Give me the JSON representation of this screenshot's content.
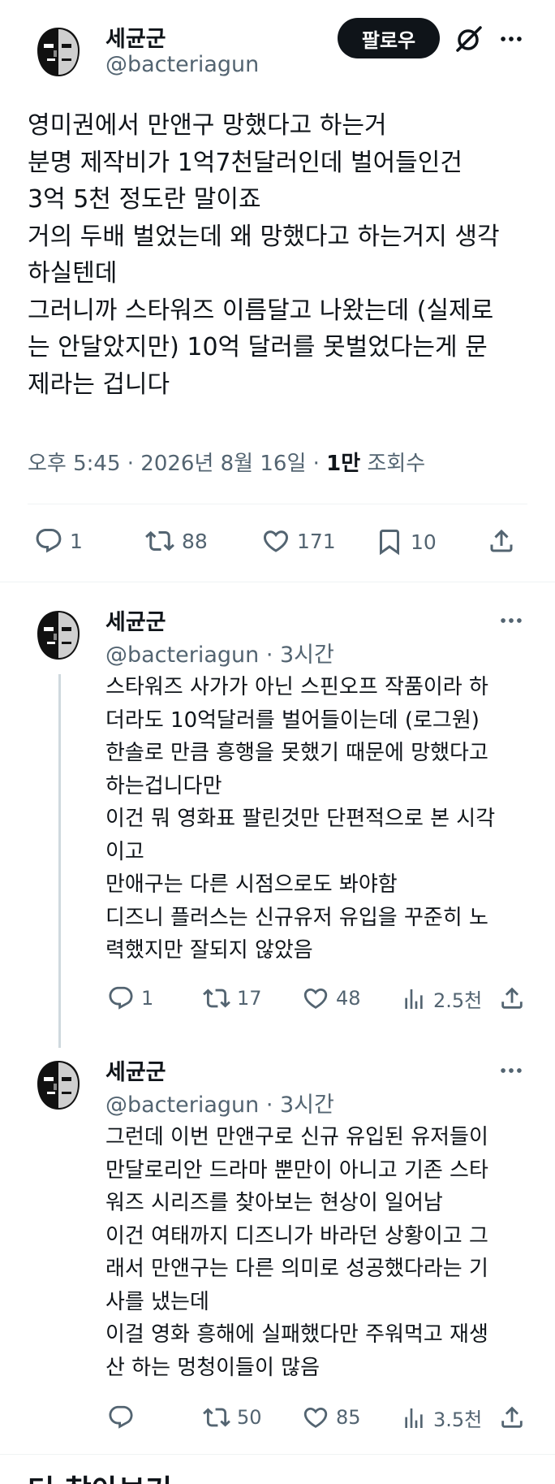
{
  "main_post": {
    "author_name": "세균군",
    "author_handle": "@bacteriagun",
    "follow_label": "팔로우",
    "text": "영미권에서 만앤구 망했다고 하는거\n분명 제작비가 1억7천달러인데 벌어들인건\n3억 5천 정도란 말이죠\n거의 두배 벌었는데 왜 망했다고 하는거지 생각\n하실텐데\n그러니까 스타워즈 이름달고 나왔는데 (실제로\n는 안달았지만) 10억 달러를 못벌었다는게 문\n제라는 겁니다",
    "timestamp": "오후 5:45 · 2026년 8월 16일 · ",
    "views_count": "1만",
    "views_label": " 조회수",
    "replies": "1",
    "reposts": "88",
    "likes": "171",
    "bookmarks": "10"
  },
  "replies": [
    {
      "author_name": "세균군",
      "author_handle": "@bacteriagun · 3시간",
      "text": "스타워즈 사가가 아닌 스핀오프 작품이라 하\n더라도 10억달러를 벌어들이는데 (로그원)\n한솔로 만큼 흥행을 못했기 때문에 망했다고\n하는겁니다만\n이건 뭐 영화표 팔린것만 단편적으로 본 시각\n이고\n만애구는 다른 시점으로도 봐야함\n디즈니 플러스는 신규유저 유입을 꾸준히 노\n력했지만 잘되지 않았음",
      "replies": "1",
      "reposts": "17",
      "likes": "48",
      "views": "2.5천"
    },
    {
      "author_name": "세균군",
      "author_handle": "@bacteriagun · 3시간",
      "text": "그런데 이번 만앤구로 신규 유입된 유저들이\n만달로리안 드라마 뿐만이 아니고 기존 스타\n워즈 시리즈를 찾아보는 현상이 일어남\n이건 여태까지 디즈니가 바라던 상황이고 그\n래서 만앤구는 다른 의미로 성공했다라는 기\n사를 냈는데\n이걸 영화 흥해에 실패했다만 주워먹고 재생\n산 하는 멍청이들이 많음",
      "replies": "",
      "reposts": "50",
      "likes": "85",
      "views": "3.5천"
    }
  ],
  "section_title": "더 찾아보기",
  "icons": [
    "avatar-icon",
    "grok-icon",
    "more-icon",
    "reply-icon",
    "repost-icon",
    "like-icon",
    "bookmark-icon",
    "share-icon",
    "views-icon"
  ],
  "colors": {
    "text": "#0f1419",
    "secondary": "#536471",
    "divider": "#eff3f4",
    "button": "#0f1419"
  }
}
